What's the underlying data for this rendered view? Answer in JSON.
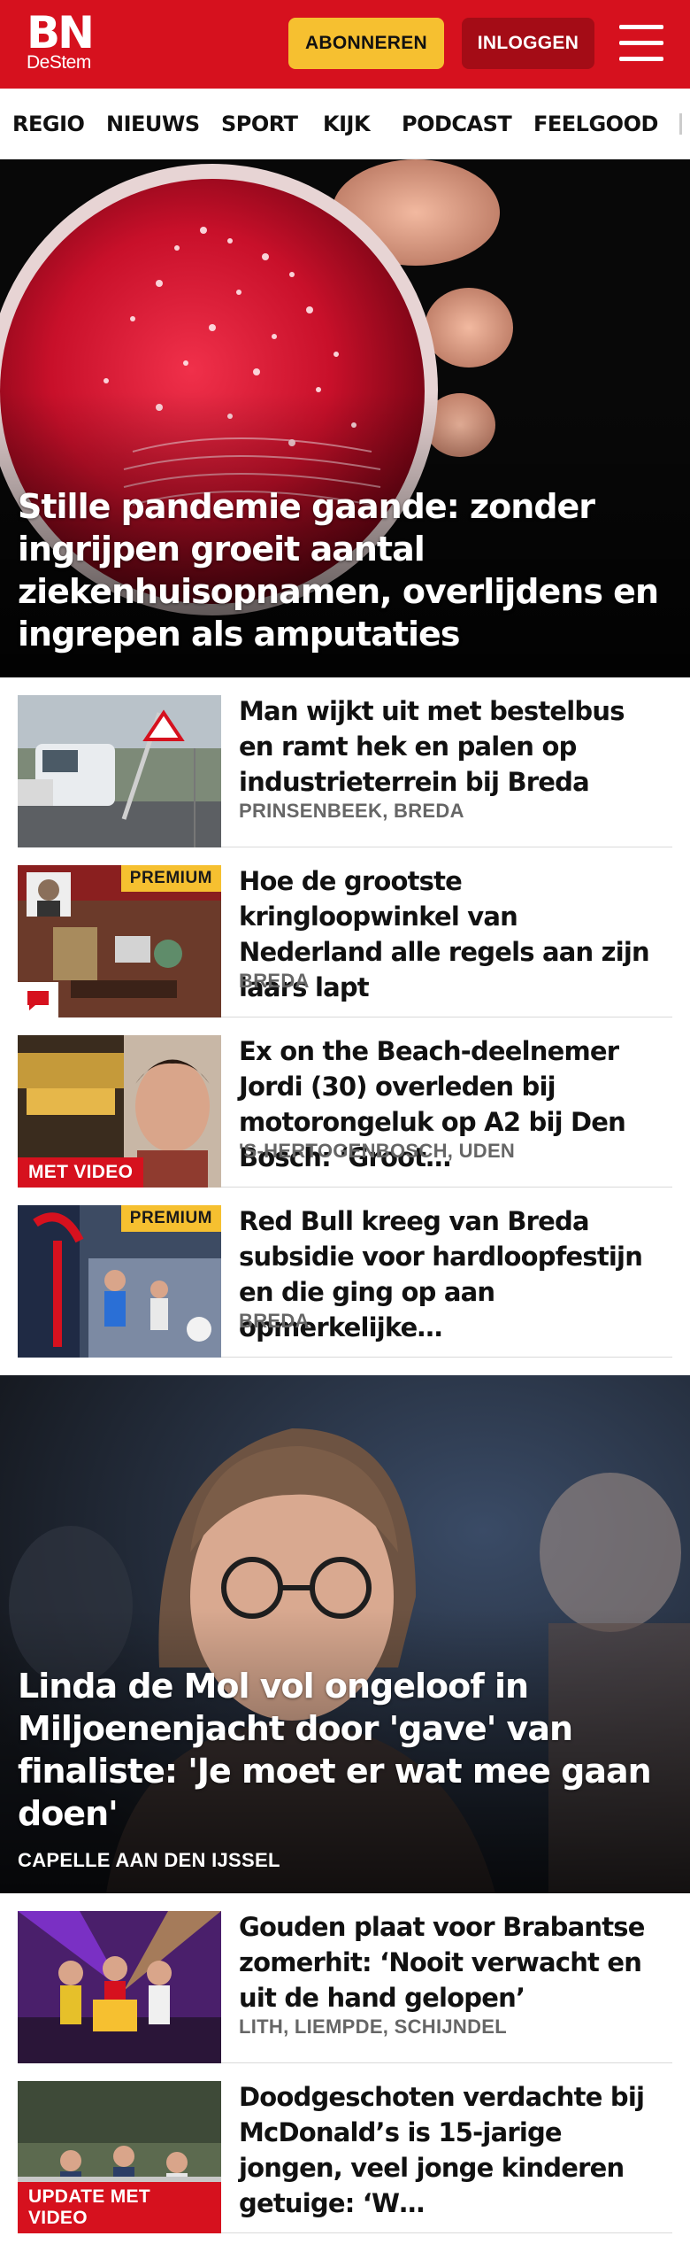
{
  "header": {
    "logo_main": "BN",
    "logo_sub": "DeStem",
    "subscribe_label": "ABONNEREN",
    "login_label": "INLOGGEN",
    "menu_icon": "hamburger-menu-icon",
    "brand_color": "#d6111e",
    "accent_color": "#f6c030"
  },
  "nav": {
    "items": [
      "REGIO",
      "NIEUWS",
      "SPORT",
      "KIJK",
      "PODCAST",
      "FEELGOOD"
    ]
  },
  "hero1": {
    "title": "Stille pandemie gaande: zonder ingrijpen groeit aantal ziekenhuisop­namen, overlijdens en ingrepen als amputaties"
  },
  "articles": [
    {
      "title": "Man wijkt uit met bestelbus en ramt hek en palen op industrie­terrein bij Breda",
      "location": "PRINSENBEEK, BREDA"
    },
    {
      "title": "Hoe de grootste kringloopwinkel van Nederland alle regels aan zijn laars lapt",
      "location": "BREDA",
      "badge": "PREMIUM",
      "icon": "comment-icon"
    },
    {
      "title": "Ex on the Beach-deelnemer Jordi (30) overleden bij motorongeluk op A2 bij Den Bosch: ‘Groot…",
      "location": "'S-HERTOGENBOSCH, UDEN",
      "badge": "MET VIDEO"
    },
    {
      "title": "Red Bull kreeg van Breda subsidie voor hardloopfestijn en die ging op aan opmerkelijke…",
      "location": "BREDA",
      "badge": "PREMIUM"
    }
  ],
  "hero2": {
    "title": "Linda de Mol vol ongeloof in Miljoenenjacht door 'gave' van finaliste: 'Je moet er wat mee gaan doen'",
    "location": "CAPELLE AAN DEN IJSSEL"
  },
  "articles2": [
    {
      "title": "Gouden plaat voor Brabantse zomerhit: ‘Nooit verwacht en uit de hand gelopen’",
      "location": "LITH, LIEMPDE, SCHIJNDEL"
    },
    {
      "title": "Doodgeschoten verdachte bij McDonald’s is 15-jarige jongen, veel jonge kinderen getuige: ‘W…",
      "location": "",
      "badge": "UPDATE MET VIDEO"
    }
  ]
}
